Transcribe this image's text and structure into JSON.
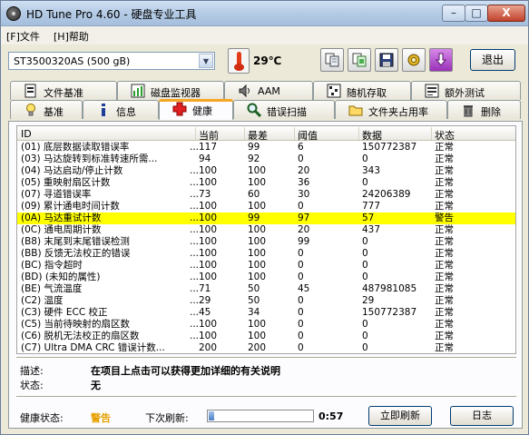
{
  "window": {
    "title": "HD Tune Pro 4.60 - 硬盘专业工具",
    "minimize": "–",
    "maximize": "□",
    "close": "X"
  },
  "menu": {
    "file": "[F]文件",
    "help": "[H]帮助"
  },
  "toolbar": {
    "drive": "ST3500320AS  (500 gB)",
    "temperature": "29℃",
    "exit_label": "退出",
    "icons": [
      "copy-icon",
      "copy-screen-icon",
      "save-icon",
      "options-icon",
      "download-icon"
    ]
  },
  "tabs": {
    "row1": [
      {
        "label": "文件基准",
        "icon": "file-benchmark-icon"
      },
      {
        "label": "磁盘监视器",
        "icon": "disk-monitor-icon"
      },
      {
        "label": "AAM",
        "icon": "speaker-icon"
      },
      {
        "label": "随机存取",
        "icon": "random-access-icon"
      },
      {
        "label": "额外测试",
        "icon": "extra-tests-icon"
      }
    ],
    "row2": [
      {
        "label": "基准",
        "icon": "benchmark-icon"
      },
      {
        "label": "信息",
        "icon": "info-icon"
      },
      {
        "label": "健康",
        "icon": "health-cross-icon"
      },
      {
        "label": "错误扫描",
        "icon": "magnifier-icon"
      },
      {
        "label": "文件夹占用率",
        "icon": "folder-icon"
      },
      {
        "label": "删除",
        "icon": "trash-icon"
      }
    ],
    "active": "健康"
  },
  "table": {
    "headers": {
      "id": "ID",
      "current": "当前",
      "worst": "最差",
      "threshold": "阈值",
      "data": "数据",
      "status": "状态"
    },
    "rows": [
      {
        "id": "(01) 底层数据读取错误率",
        "dots": "...",
        "current": "117",
        "worst": "99",
        "threshold": "6",
        "data": "150772387",
        "status": "正常",
        "warn": false
      },
      {
        "id": "(03) 马达旋转到标准转速所需...",
        "dots": "",
        "current": "94",
        "worst": "92",
        "threshold": "0",
        "data": "0",
        "status": "正常",
        "warn": false
      },
      {
        "id": "(04) 马达启动/停止计数",
        "dots": "...",
        "current": "100",
        "worst": "100",
        "threshold": "20",
        "data": "343",
        "status": "正常",
        "warn": false
      },
      {
        "id": "(05) 重映射扇区计数",
        "dots": "...",
        "current": "100",
        "worst": "100",
        "threshold": "36",
        "data": "0",
        "status": "正常",
        "warn": false
      },
      {
        "id": "(07) 寻道错误率",
        "dots": "...",
        "current": "73",
        "worst": "60",
        "threshold": "30",
        "data": "24206389",
        "status": "正常",
        "warn": false
      },
      {
        "id": "(09) 累计通电时间计数",
        "dots": "...",
        "current": "100",
        "worst": "100",
        "threshold": "0",
        "data": "777",
        "status": "正常",
        "warn": false
      },
      {
        "id": "(0A) 马达重试计数",
        "dots": "...",
        "current": "100",
        "worst": "99",
        "threshold": "97",
        "data": "57",
        "status": "警告",
        "warn": true
      },
      {
        "id": "(0C) 通电周期计数",
        "dots": "...",
        "current": "100",
        "worst": "100",
        "threshold": "20",
        "data": "437",
        "status": "正常",
        "warn": false
      },
      {
        "id": "(B8) 末尾到末尾错误检测",
        "dots": "...",
        "current": "100",
        "worst": "100",
        "threshold": "99",
        "data": "0",
        "status": "正常",
        "warn": false
      },
      {
        "id": "(BB) 反馈无法校正的错误",
        "dots": "...",
        "current": "100",
        "worst": "100",
        "threshold": "0",
        "data": "0",
        "status": "正常",
        "warn": false
      },
      {
        "id": "(BC) 指令超时",
        "dots": "...",
        "current": "100",
        "worst": "100",
        "threshold": "0",
        "data": "0",
        "status": "正常",
        "warn": false
      },
      {
        "id": "(BD) (未知的属性)",
        "dots": "...",
        "current": "100",
        "worst": "100",
        "threshold": "0",
        "data": "0",
        "status": "正常",
        "warn": false
      },
      {
        "id": "(BE) 气流温度",
        "dots": "...",
        "current": "71",
        "worst": "50",
        "threshold": "45",
        "data": "487981085",
        "status": "正常",
        "warn": false
      },
      {
        "id": "(C2) 温度",
        "dots": "...",
        "current": "29",
        "worst": "50",
        "threshold": "0",
        "data": "29",
        "status": "正常",
        "warn": false
      },
      {
        "id": "(C3) 硬件 ECC 校正",
        "dots": "...",
        "current": "45",
        "worst": "34",
        "threshold": "0",
        "data": "150772387",
        "status": "正常",
        "warn": false
      },
      {
        "id": "(C5) 当前待映射的扇区数",
        "dots": "...",
        "current": "100",
        "worst": "100",
        "threshold": "0",
        "data": "0",
        "status": "正常",
        "warn": false
      },
      {
        "id": "(C6) 脱机无法校正的扇区数",
        "dots": "...",
        "current": "100",
        "worst": "100",
        "threshold": "0",
        "data": "0",
        "status": "正常",
        "warn": false
      },
      {
        "id": "(C7) Ultra DMA CRC 错误计数...",
        "dots": "",
        "current": "200",
        "worst": "200",
        "threshold": "0",
        "data": "0",
        "status": "正常",
        "warn": false
      }
    ]
  },
  "info": {
    "desc_label": "描述:",
    "desc_value": "在项目上点击可以获得更加详细的有关说明",
    "status_label": "状态:",
    "status_value": "无"
  },
  "footer": {
    "health_label": "健康状态:",
    "health_value": "警告",
    "refresh_label": "下次刷新:",
    "refresh_progress": 0.05,
    "refresh_time": "0:57",
    "refresh_now": "立即刷新",
    "log": "日志"
  },
  "colors": {
    "warning_row": "#ffff00",
    "warning_text": "#e6a000"
  }
}
